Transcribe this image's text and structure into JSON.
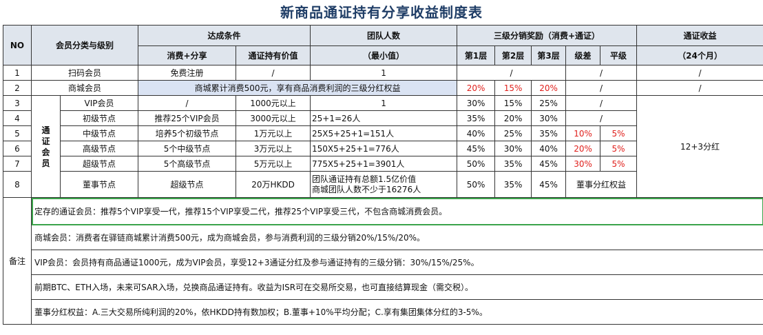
{
  "title": "新商品通证持有分享收益制度表",
  "header": {
    "no": "NO",
    "member": "会员分类与级别",
    "cond": "达成条件",
    "cond_consume": "消费+分享",
    "cond_hold": "通证持有价值",
    "team": "团队人数",
    "team_min": "（最小值）",
    "reward": "三级分销奖励（消费+通证）",
    "l1": "第1层",
    "l2": "第2层",
    "l3": "第3层",
    "diff": "级差",
    "flat": "平级",
    "income": "通证收益",
    "income_sub": "（24个月）"
  },
  "tongzheng_label": "通证会员",
  "rows": [
    {
      "no": "1",
      "name": "扫码会员",
      "consume": "免费注册",
      "hold": "/",
      "team": "1",
      "levels": "/",
      "diffflat": "/",
      "income": "/"
    },
    {
      "no": "2",
      "name": "商城会员",
      "merged": "商城累计消费500元，享有商品消费利润的三级分红权益",
      "l1": "20%",
      "l2": "15%",
      "l3": "20%",
      "diffflat": "/",
      "income": "/"
    },
    {
      "no": "3",
      "name": "VIP会员",
      "consume": "/",
      "hold": "1000元以上",
      "team": "1",
      "l1": "30%",
      "l2": "15%",
      "l3": "25%",
      "diffflat": "/"
    },
    {
      "no": "4",
      "name": "初级节点",
      "consume": "推荐25个VIP会员",
      "hold": "3000元以上",
      "team": "25+1=26人",
      "l1": "35%",
      "l2": "20%",
      "l3": "30%",
      "diffflat": "/"
    },
    {
      "no": "5",
      "name": "中级节点",
      "consume": "培养5个初级节点",
      "hold": "1万元以上",
      "team": "25X5+25+1=151人",
      "l1": "40%",
      "l2": "25%",
      "l3": "35%",
      "diff": "10%",
      "flat": "5%"
    },
    {
      "no": "6",
      "name": "高级节点",
      "consume": "5个中级节点",
      "hold": "3万元以上",
      "team": "150X5+25+1=776人",
      "l1": "45%",
      "l2": "30%",
      "l3": "40%",
      "diff": "20%",
      "flat": "5%"
    },
    {
      "no": "7",
      "name": "超级节点",
      "consume": "5个高级节点",
      "hold": "5万元以上",
      "team": "775X5+25+1=3901人",
      "l1": "50%",
      "l2": "35%",
      "l3": "45%",
      "diff": "30%",
      "flat": "5%"
    },
    {
      "no": "8",
      "name": "董事节点",
      "consume": "超级节点",
      "hold": "20万HKDD",
      "team1": "团队通证持有总额1.5亿价值",
      "team2": "商城团队人数不少于16276人",
      "l1": "50%",
      "l2": "35%",
      "l3": "45%",
      "diffflat": "董事分红权益"
    }
  ],
  "income_vip": "12+3分红",
  "notes_label": "备注",
  "notes": [
    "定存的通证会员：推荐5个VIP享受一代，推荐15个VIP享受二代，推荐25个VIP享受三代，不包含商城消费会员。",
    "商城会员：消费者在驿链商城累计消费500元，成为商城会员，参与消费利润的三级分销20%/15%/20%。",
    "VIP会员：会员持有商品通证1000元，成为VIP会员，享受12+3通证分红及参与通证持有的三级分销：30%/15%/25%。",
    "前期BTC、ETH入场，未来可SAR入场，兑换商品通证持有。收益为ISR可在交易所交易，也可直接结算现金（需交税）。",
    "董事分红权益：A.三大交易所纯利润的20%，依HKDD持有数加权；B.董事+10%平均分配；C.享有集团集体分红的3-5%。"
  ]
}
